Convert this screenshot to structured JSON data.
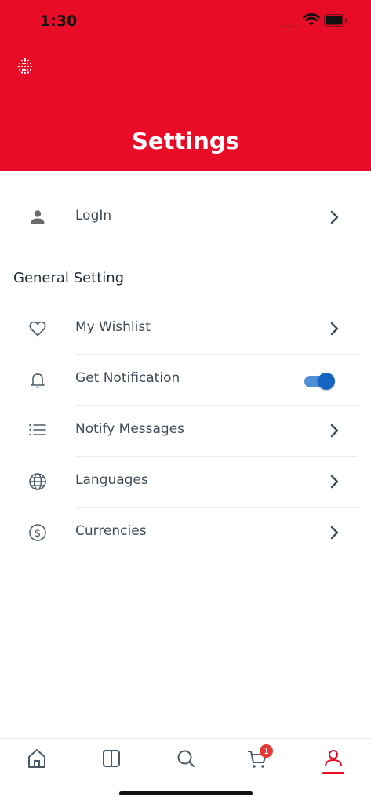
{
  "status_bar": {
    "time": "1:30"
  },
  "header": {
    "title": "Settings"
  },
  "login": {
    "label": "LogIn"
  },
  "general": {
    "title": "General Setting",
    "items": [
      {
        "label": "My Wishlist",
        "icon": "heart-icon"
      },
      {
        "label": "Get Notification",
        "icon": "bell-icon",
        "toggle_on": true
      },
      {
        "label": "Notify Messages",
        "icon": "list-icon"
      },
      {
        "label": "Languages",
        "icon": "globe-icon"
      },
      {
        "label": "Currencies",
        "icon": "dollar-circle-icon"
      }
    ]
  },
  "tabbar": {
    "tabs": [
      "home-icon",
      "book-icon",
      "search-icon",
      "cart-icon",
      "user-icon"
    ],
    "cart_badge": "1",
    "active": "user-icon"
  },
  "colors": {
    "brand": "#e80c28",
    "toggle": "#1565c0"
  }
}
